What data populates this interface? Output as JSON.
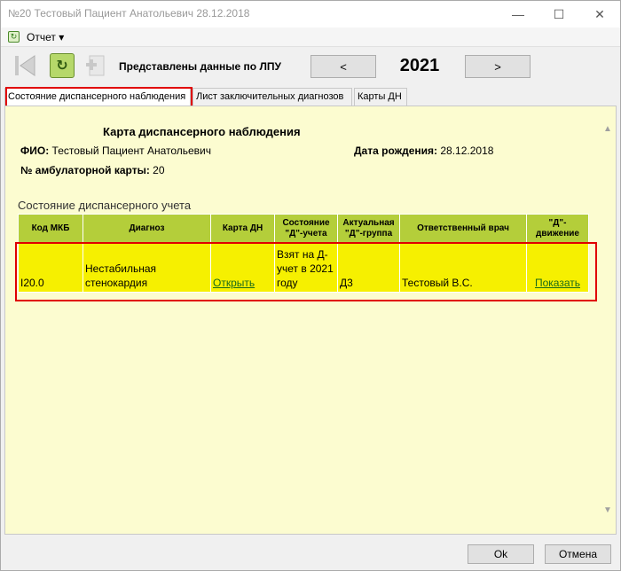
{
  "window": {
    "title": "№20 Тестовый Пациент Анатольевич 28.12.2018"
  },
  "menu": {
    "report": "Отчет ▾"
  },
  "toolbar": {
    "label": "Представлены данные по ЛПУ",
    "prev": "<",
    "next": ">",
    "year": "2021"
  },
  "tabs": [
    {
      "label": "Состояние диспансерного наблюдения"
    },
    {
      "label": "Лист заключительных диагнозов"
    },
    {
      "label": "Карты ДН"
    }
  ],
  "card": {
    "title": "Карта диспансерного наблюдения",
    "fio_label": "ФИО:",
    "fio_value": " Тестовый Пациент Анатольевич",
    "birth_label": "Дата рождения:",
    "birth_value": " 28.12.2018",
    "card_no_label": "№ амбулаторной карты:",
    "card_no_value": " 20"
  },
  "table": {
    "section_title": "Состояние диспансерного учета",
    "headers": [
      "Код МКБ",
      "Диагноз",
      "Карта ДН",
      "Состояние \"Д\"-учета",
      "Актуальная \"Д\"-группа",
      "Ответственный врач",
      "\"Д\"-движение"
    ],
    "rows": [
      {
        "code": "I20.0",
        "diagnosis": "Нестабильная стенокардия",
        "card_link": "Открыть",
        "state": "Взят на Д-учет в 2021 году",
        "group": "Д3",
        "doctor": "Тестовый В.С.",
        "movement_link": "Показать"
      }
    ]
  },
  "buttons": {
    "ok": "Ok",
    "cancel": "Отмена"
  }
}
